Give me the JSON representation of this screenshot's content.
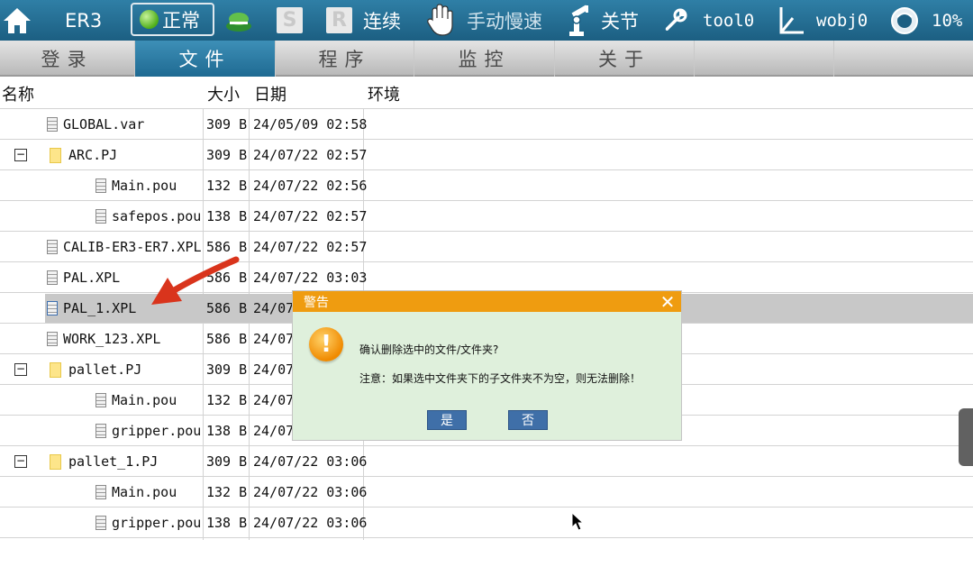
{
  "status_bar": {
    "robot": "ER3",
    "state": "正常",
    "mode_s": "S",
    "mode_r": "R",
    "run_mode": "连续",
    "speed_mode": "手动慢速",
    "coord": "关节",
    "tool": "tool0",
    "wobj": "wobj0",
    "speed": "10%"
  },
  "tabs": [
    {
      "label": "登录"
    },
    {
      "label": "文件"
    },
    {
      "label": "程序"
    },
    {
      "label": "监控"
    },
    {
      "label": "关于"
    }
  ],
  "table": {
    "headers": {
      "name": "名称",
      "size": "大小",
      "date": "日期",
      "env": "环境"
    },
    "rows": [
      {
        "name": "GLOBAL.var",
        "size": "309 B",
        "date": "24/05/09 02:58"
      },
      {
        "name": "ARC.PJ",
        "size": "309 B",
        "date": "24/07/22 02:57"
      },
      {
        "name": "Main.pou",
        "size": "132 B",
        "date": "24/07/22 02:56"
      },
      {
        "name": "safepos.pou",
        "size": "138 B",
        "date": "24/07/22 02:57"
      },
      {
        "name": "CALIB-ER3-ER7.XPL",
        "size": "586 B",
        "date": "24/07/22 02:57"
      },
      {
        "name": "PAL.XPL",
        "size": "586 B",
        "date": "24/07/22 03:03"
      },
      {
        "name": "PAL_1.XPL",
        "size": "586 B",
        "date": "24/07"
      },
      {
        "name": "WORK_123.XPL",
        "size": "586 B",
        "date": "24/07"
      },
      {
        "name": "pallet.PJ",
        "size": "309 B",
        "date": "24/07"
      },
      {
        "name": "Main.pou",
        "size": "132 B",
        "date": "24/07"
      },
      {
        "name": "gripper.pou",
        "size": "138 B",
        "date": "24/07"
      },
      {
        "name": "pallet_1.PJ",
        "size": "309 B",
        "date": "24/07/22 03:06"
      },
      {
        "name": "Main.pou",
        "size": "132 B",
        "date": "24/07/22 03:06"
      },
      {
        "name": "gripper.pou",
        "size": "138 B",
        "date": "24/07/22 03:06"
      }
    ]
  },
  "dialog": {
    "title": "警告",
    "message": "确认删除选中的文件/文件夹?",
    "note": "注意：如果选中文件夹下的子文件夹不为空，则无法删除！",
    "yes": "是",
    "no": "否"
  },
  "colors": {
    "accent": "#1f6a92",
    "dialog_title": "#ef9c10",
    "dialog_bg": "#dff0dc"
  }
}
